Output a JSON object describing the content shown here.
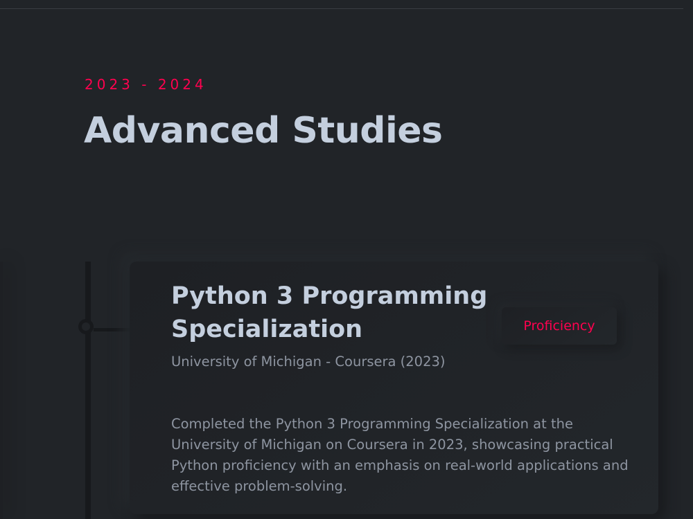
{
  "section": {
    "years": "2023 - 2024",
    "title": "Advanced Studies"
  },
  "item": {
    "title": "Python 3 Programming Specialization",
    "subtitle": "University of Michigan - Coursera (2023)",
    "badge": "Proficiency",
    "description": "Completed the Python 3 Programming Specialization at the University of Michigan on Coursera in 2023, showcasing practical Python proficiency with an emphasis on real-world applications and effective problem-solving."
  },
  "colors": {
    "background": "#212428",
    "accent": "#ff014f",
    "heading": "#c4cfde",
    "body_text": "#8e95a1"
  }
}
